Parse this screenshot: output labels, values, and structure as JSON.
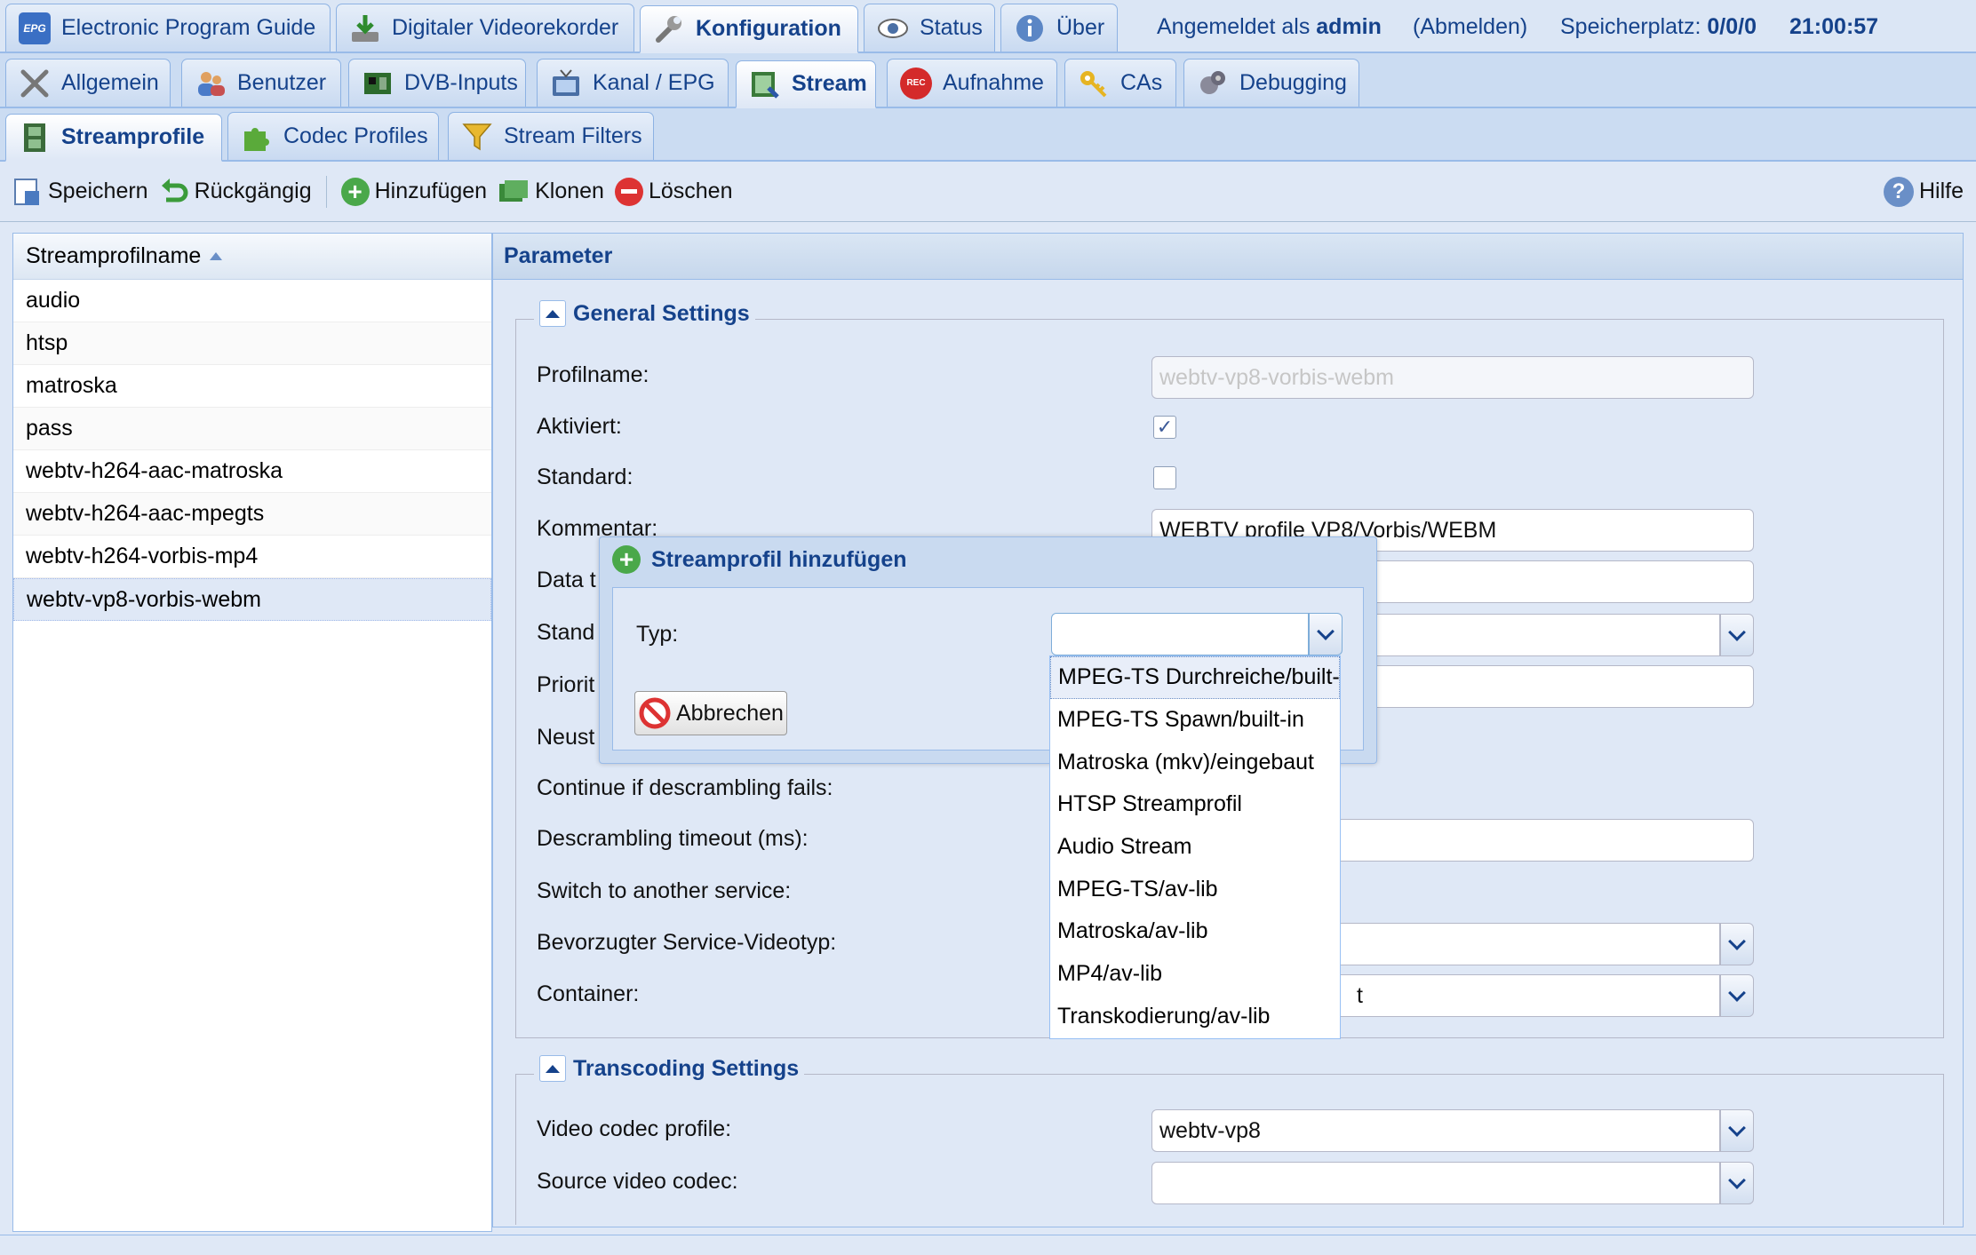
{
  "colors": {
    "accent": "#15428b",
    "border": "#99bbe8",
    "background": "#dfe8f6"
  },
  "top_tabs": [
    {
      "label": "Electronic Program Guide",
      "icon": "epg-icon"
    },
    {
      "label": "Digitaler Videorekorder",
      "icon": "download-icon"
    },
    {
      "label": "Konfiguration",
      "icon": "wrench-icon",
      "active": true
    },
    {
      "label": "Status",
      "icon": "eye-icon"
    },
    {
      "label": "Über",
      "icon": "info-icon"
    }
  ],
  "header": {
    "login_prefix": "Angemeldet als",
    "user": "admin",
    "logout": "(Abmelden)",
    "storage_label": "Speicherplatz:",
    "storage_value": "0/0/0",
    "time": "21:00:57"
  },
  "sub_tabs": [
    {
      "label": "Allgemein",
      "icon": "tools-icon"
    },
    {
      "label": "Benutzer",
      "icon": "users-icon"
    },
    {
      "label": "DVB-Inputs",
      "icon": "card-icon"
    },
    {
      "label": "Kanal / EPG",
      "icon": "tv-icon"
    },
    {
      "label": "Stream",
      "icon": "stream-icon",
      "active": true
    },
    {
      "label": "Aufnahme",
      "icon": "rec-icon"
    },
    {
      "label": "CAs",
      "icon": "key-icon"
    },
    {
      "label": "Debugging",
      "icon": "bug-icon"
    }
  ],
  "third_tabs": [
    {
      "label": "Streamprofile",
      "icon": "film-icon",
      "active": true
    },
    {
      "label": "Codec Profiles",
      "icon": "puzzle-icon"
    },
    {
      "label": "Stream Filters",
      "icon": "filter-icon"
    }
  ],
  "toolbar": {
    "save": "Speichern",
    "undo": "Rückgängig",
    "add": "Hinzufügen",
    "clone": "Klonen",
    "delete": "Löschen",
    "help": "Hilfe"
  },
  "grid": {
    "column": "Streamprofilname",
    "rows": [
      "audio",
      "htsp",
      "matroska",
      "pass",
      "webtv-h264-aac-matroska",
      "webtv-h264-aac-mpegts",
      "webtv-h264-vorbis-mp4",
      "webtv-vp8-vorbis-webm"
    ],
    "selected_index": 7
  },
  "panel": {
    "title": "Parameter"
  },
  "general": {
    "legend": "General Settings",
    "profile_label": "Profilname:",
    "profile_value": "webtv-vp8-vorbis-webm",
    "enabled_label": "Aktiviert:",
    "enabled": true,
    "default_label": "Standard:",
    "default": false,
    "comment_label": "Kommentar:",
    "comment_value": "WEBTV profile VP8/Vorbis/WEBM",
    "data_label": "Data t",
    "standard_label": "Stand",
    "priority_label": "Priorit",
    "restart_label": "Neust",
    "descramble_fail_label": "Continue if descrambling fails:",
    "descramble_timeout_label": "Descrambling timeout (ms):",
    "switch_label": "Switch to another service:",
    "videotype_label": "Bevorzugter Service-Videotyp:",
    "container_label": "Container:",
    "container_value_tail": "t"
  },
  "transcoding": {
    "legend": "Transcoding Settings",
    "video_profile_label": "Video codec profile:",
    "video_profile_value": "webtv-vp8",
    "source_codec_label": "Source video codec:"
  },
  "modal": {
    "title": "Streamprofil hinzufügen",
    "type_label": "Typ:",
    "type_value": "",
    "cancel": "Abbrechen"
  },
  "type_options": [
    "MPEG-TS Durchreiche/built-in",
    "MPEG-TS Spawn/built-in",
    "Matroska (mkv)/eingebaut",
    "HTSP Streamprofil",
    "Audio Stream",
    "MPEG-TS/av-lib",
    "Matroska/av-lib",
    "MP4/av-lib",
    "Transkodierung/av-lib"
  ],
  "highlighted_option": 0
}
